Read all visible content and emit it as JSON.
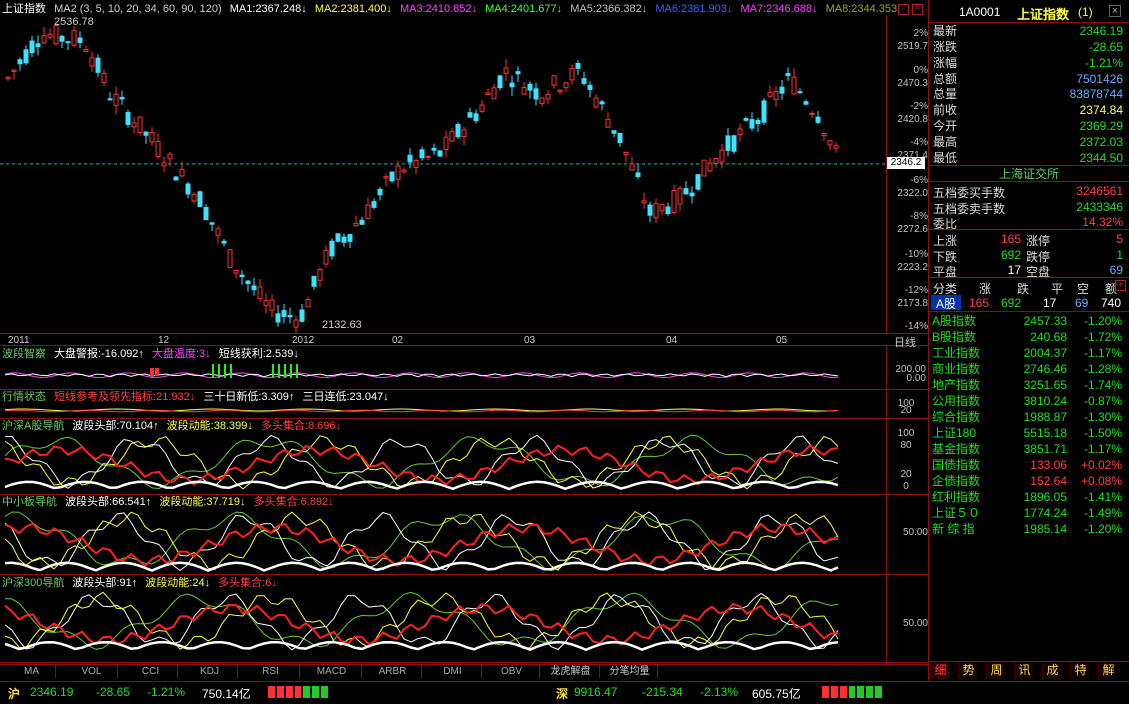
{
  "main_header": {
    "name": "上证指数",
    "ma_params": "MA2 (3, 5, 10, 20, 34, 60, 90, 120)",
    "ma": [
      {
        "text": "MA1:2367.248↓",
        "color": "#ffffff"
      },
      {
        "text": "MA2:2381.400↓",
        "color": "#ffff40"
      },
      {
        "text": "MA3:2410.852↓",
        "color": "#ff40ff"
      },
      {
        "text": "MA4:2401.677↓",
        "color": "#40ff40"
      },
      {
        "text": "MA5:2366.382↓",
        "color": "#c0c0c0"
      },
      {
        "text": "MA6:2381.903↓",
        "color": "#4040ff"
      },
      {
        "text": "MA7:2346.688↓",
        "color": "#ff40ff"
      },
      {
        "text": "MA8:2344.353",
        "color": "#a0a040"
      }
    ],
    "high_label": "2536.78",
    "low_label": "2132.63",
    "current_tag": "2346.2"
  },
  "price_axis": [
    {
      "pct": "2%",
      "price": "2519.7"
    },
    {
      "pct": "0%",
      "price": "2470.3"
    },
    {
      "pct": "-2%",
      "price": "2420.8"
    },
    {
      "pct": "-4%",
      "price": "2371.4"
    },
    {
      "pct": "-6%",
      "price": "2322.0"
    },
    {
      "pct": "-8%",
      "price": "2272.6"
    },
    {
      "pct": "-10%",
      "price": "2223.2"
    },
    {
      "pct": "-12%",
      "price": "2173.8"
    },
    {
      "pct": "-14%",
      "price": ""
    }
  ],
  "date_axis": [
    "2011",
    "12",
    "2012",
    "02",
    "03",
    "04",
    "05"
  ],
  "period_label": "日线",
  "panes": [
    {
      "name": "波段智察",
      "items": [
        {
          "text": "大盘警报:-16.092↑",
          "color": "#ffffff"
        },
        {
          "text": "大盘温度:3↓",
          "color": "#ff40ff"
        },
        {
          "text": "短线获利:2.539↓",
          "color": "#ffffff"
        }
      ],
      "axis": [
        "200.00",
        "0.00"
      ]
    },
    {
      "name": "行情状态",
      "items": [
        {
          "text": "短线参考及领先指标:21.932↓",
          "color": "#ff4040"
        },
        {
          "text": "三十日新低:3.309↑",
          "color": "#ffffff"
        },
        {
          "text": "三日连低:23.047↓",
          "color": "#ffffff"
        }
      ],
      "axis": [
        "100",
        "20"
      ]
    },
    {
      "name": "沪深A股导航",
      "items": [
        {
          "text": "波段头部:70.104↑",
          "color": "#ffffff"
        },
        {
          "text": "波段动能:38.399↓",
          "color": "#ffff40"
        },
        {
          "text": "多头集合:8.696↓",
          "color": "#ff4040"
        }
      ],
      "axis": [
        "100",
        "80",
        "20",
        "0"
      ]
    },
    {
      "name": "中小板导航",
      "items": [
        {
          "text": "波段头部:66.541↑",
          "color": "#ffffff"
        },
        {
          "text": "波段动能:37.719↓",
          "color": "#ffff40"
        },
        {
          "text": "多头集合:6.892↓",
          "color": "#ff4040"
        }
      ],
      "axis": [
        "50.00"
      ]
    },
    {
      "name": "沪深300导航",
      "items": [
        {
          "text": "波段头部:91↑",
          "color": "#ffffff"
        },
        {
          "text": "波段动能:24↓",
          "color": "#ffff40"
        },
        {
          "text": "多头集合:6↓",
          "color": "#ff4040"
        }
      ],
      "axis": [
        "50.00"
      ]
    }
  ],
  "bottom_tabs": [
    "MA",
    "VOL",
    "CCI",
    "KDJ",
    "RSI",
    "MACD",
    "ARBR",
    "DMI",
    "OBV",
    "龙虎解盘",
    "分笔均量"
  ],
  "quote": {
    "code": "1A0001",
    "title": "上证指数",
    "flag": "(1)",
    "rows": [
      {
        "k": "最新",
        "v": "2346.19",
        "c": "#22dd22"
      },
      {
        "k": "涨跌",
        "v": "-28.65",
        "c": "#22dd22"
      },
      {
        "k": "涨幅",
        "v": "-1.21%",
        "c": "#22dd22"
      },
      {
        "k": "总额",
        "v": "7501426",
        "c": "#66aaff"
      },
      {
        "k": "总量",
        "v": "83878744",
        "c": "#66aaff"
      },
      {
        "k": "前收",
        "v": "2374.84",
        "c": "#ffff66"
      },
      {
        "k": "今开",
        "v": "2369.29",
        "c": "#22dd22"
      },
      {
        "k": "最高",
        "v": "2372.03",
        "c": "#22dd22"
      },
      {
        "k": "最低",
        "v": "2344.50",
        "c": "#22dd22"
      }
    ],
    "exchange": "上海证交所",
    "book": [
      {
        "k": "五档委买手数",
        "v": "3246561",
        "c": "#ff4040"
      },
      {
        "k": "五档委卖手数",
        "v": "2433346",
        "c": "#22dd22"
      },
      {
        "k": "委比",
        "v": "14.32%",
        "c": "#ff4040"
      }
    ],
    "breadth": [
      {
        "k1": "上涨",
        "v1": "165",
        "c1": "#ff4040",
        "k2": "涨停",
        "v2": "5",
        "c2": "#ff4040"
      },
      {
        "k1": "下跌",
        "v1": "692",
        "c1": "#22dd22",
        "k2": "跌停",
        "v2": "1",
        "c2": "#22dd22"
      },
      {
        "k1": "平盘",
        "v1": "17",
        "c1": "#ffffff",
        "k2": "空盘",
        "v2": "69",
        "c2": "#66aaff"
      }
    ],
    "class_header": [
      "分类",
      "涨",
      "跌",
      "平",
      "空",
      "额"
    ],
    "class_row": {
      "name": "A股",
      "up": "165",
      "down": "692",
      "flat": "17",
      "empty": "69",
      "amt": "740"
    }
  },
  "indices": [
    {
      "n": "A股指数",
      "v": "2457.33",
      "p": "-1.20%",
      "c": "#22dd22"
    },
    {
      "n": "B股指数",
      "v": "240.68",
      "p": "-1.72%",
      "c": "#22dd22"
    },
    {
      "n": "工业指数",
      "v": "2004.37",
      "p": "-1.17%",
      "c": "#22dd22"
    },
    {
      "n": "商业指数",
      "v": "2746.46",
      "p": "-1.28%",
      "c": "#22dd22"
    },
    {
      "n": "地产指数",
      "v": "3251.65",
      "p": "-1.74%",
      "c": "#22dd22"
    },
    {
      "n": "公用指数",
      "v": "3810.24",
      "p": "-0.87%",
      "c": "#22dd22"
    },
    {
      "n": "综合指数",
      "v": "1988.87",
      "p": "-1.30%",
      "c": "#22dd22"
    },
    {
      "n": "上证180",
      "v": "5515.18",
      "p": "-1.50%",
      "c": "#22dd22"
    },
    {
      "n": "基金指数",
      "v": "3851.71",
      "p": "-1.17%",
      "c": "#22dd22"
    },
    {
      "n": "国债指数",
      "v": "133.06",
      "p": "+0.02%",
      "c": "#ff4040"
    },
    {
      "n": "企债指数",
      "v": "152.64",
      "p": "+0.08%",
      "c": "#ff4040"
    },
    {
      "n": "红利指数",
      "v": "1896.05",
      "p": "-1.41%",
      "c": "#22dd22"
    },
    {
      "n": "上证５０",
      "v": "1774.24",
      "p": "-1.49%",
      "c": "#22dd22"
    },
    {
      "n": "新 综 指",
      "v": "1985.14",
      "p": "-1.20%",
      "c": "#22dd22"
    }
  ],
  "right_tabs": [
    "细",
    "势",
    "周",
    "讯",
    "成",
    "特",
    "解"
  ],
  "status": {
    "sh": {
      "label": "沪",
      "price": "2346.19",
      "chg": "-28.65",
      "pct": "-1.21%",
      "amt": "750.14亿"
    },
    "sz": {
      "label": "深",
      "price": "9916.47",
      "chg": "-215.34",
      "pct": "-2.13%",
      "amt": "605.75亿"
    }
  }
}
